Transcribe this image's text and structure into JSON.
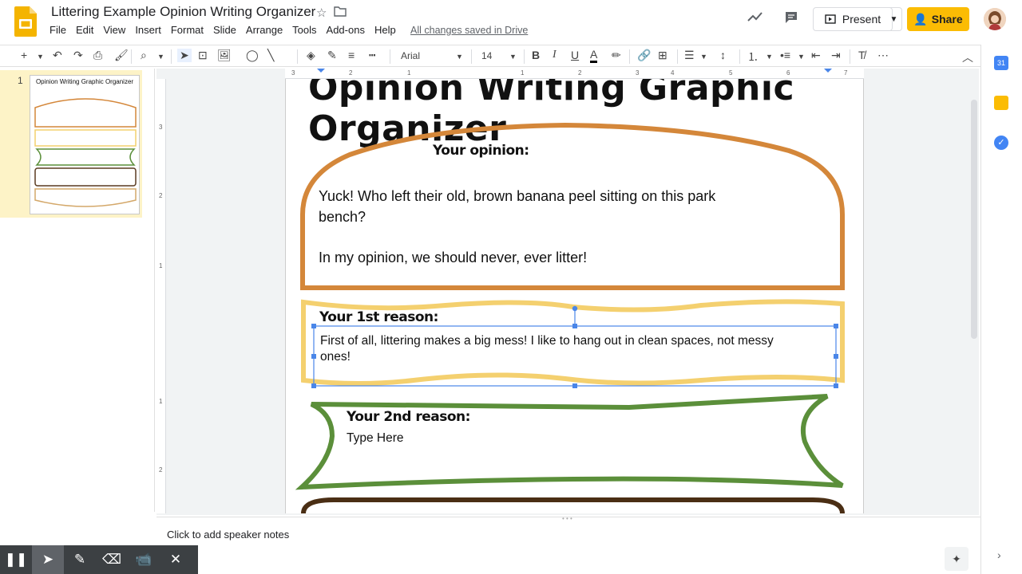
{
  "app": {
    "doc_title": "Littering Example Opinion Writing Organizer",
    "saved_status": "All changes saved in Drive",
    "present_label": "Present",
    "share_label": "Share",
    "brand_color": "#fbbc04"
  },
  "menu": [
    "File",
    "Edit",
    "View",
    "Insert",
    "Format",
    "Slide",
    "Arrange",
    "Tools",
    "Add-ons",
    "Help"
  ],
  "toolbar": {
    "font": "Arial",
    "font_size": "14"
  },
  "filmstrip": {
    "slide_number": "1",
    "thumb_title": "Opinion Writing Graphic Organizer"
  },
  "slide": {
    "title": "Opinion Writing Graphic Organizer",
    "opinion_label": "Your opinion:",
    "opinion_line1": "Yuck!  Who left their old, brown banana peel sitting on this park",
    "opinion_line2": "bench?",
    "opinion_line3": "In my opinion, we should never, ever litter!",
    "reason1_label": "Your 1st reason:",
    "reason1_text_line1": "First of all, littering makes a big mess!  I like to hang out in clean spaces, not messy",
    "reason1_text_line2": "ones!",
    "reason2_label": "Your 2nd reason:",
    "reason2_text": "Type Here"
  },
  "ruler": {
    "top_ticks": [
      "3",
      "2",
      "1",
      "1",
      "2",
      "3",
      "4",
      "5",
      "6",
      "7"
    ],
    "left_ticks": [
      "3",
      "2",
      "1",
      "1",
      "2"
    ]
  },
  "notes": {
    "placeholder": "Click to add speaker notes"
  },
  "colors": {
    "opinion_border": "#d4873a",
    "reason1_border": "#f4d06f",
    "reason2_border": "#5b8f3a",
    "selection": "#4a86e8"
  }
}
